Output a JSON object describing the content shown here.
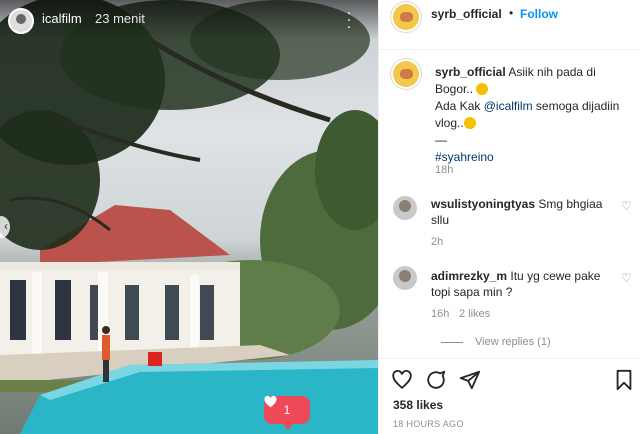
{
  "post": {
    "story_user": "icalfilm",
    "story_time": "23 menit",
    "like_count": "1"
  },
  "header": {
    "username": "syrb_official",
    "dot": "•",
    "follow_label": "Follow"
  },
  "caption": {
    "username": "syrb_official",
    "line1": "Asiik nih pada di Bogor..",
    "line2_prefix": "Ada Kak",
    "mention": "@icalfilm",
    "line2_suffix": "semoga dijadiin vlog..",
    "separator": "—",
    "hashtag": "#syahreino",
    "time": "18h"
  },
  "comments": [
    {
      "username": "wsulistyoningtyas",
      "text": "Smg bhgiaa sllu",
      "time": "2h"
    },
    {
      "username": "adimrezky_m",
      "text": "Itu yg cewe pake topi sapa min ?",
      "time": "16h",
      "likes": "2 likes",
      "replies": "View replies (1)"
    }
  ],
  "footer": {
    "likes": "358 likes",
    "posted": "18 HOURS AGO"
  },
  "icons": [
    "heart-icon",
    "comment-icon",
    "share-icon",
    "bookmark-icon",
    "more-icon"
  ],
  "colors": {
    "follow": "#0095f6",
    "like_bubble": "#ed4956",
    "pool": "#2bb6c8"
  }
}
